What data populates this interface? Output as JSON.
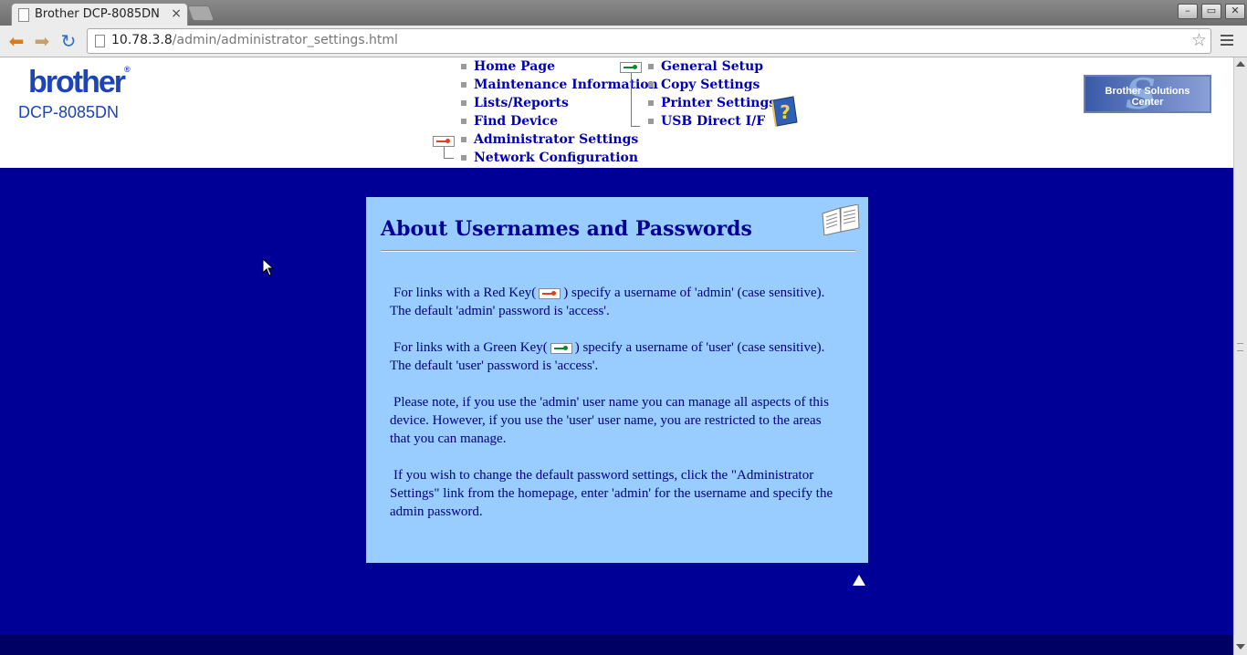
{
  "browser": {
    "tab_title": "Brother DCP-8085DN",
    "tab_close": "×",
    "url_host": "10.78.3.8",
    "url_path": "/admin/administrator_settings.html",
    "window_buttons": [
      "–",
      "▭",
      "✕"
    ]
  },
  "header": {
    "logo_text": "brother",
    "logo_mark": "®",
    "model": "DCP-8085DN",
    "solutions_center": "Brother Solutions Center"
  },
  "nav_left": [
    {
      "label": "Home Page"
    },
    {
      "label": "Maintenance Information"
    },
    {
      "label": "Lists/Reports"
    },
    {
      "label": "Find Device"
    },
    {
      "label": "Administrator Settings"
    },
    {
      "label": "Network Configuration"
    }
  ],
  "nav_right": [
    {
      "label": "General Setup"
    },
    {
      "label": "Copy Settings"
    },
    {
      "label": "Printer Settings"
    },
    {
      "label": "USB Direct I/F"
    }
  ],
  "panel": {
    "title": "About Usernames and Passwords",
    "p1_before": "For links with a Red Key(",
    "p1_after": ") specify a username of 'admin' (case sensitive). The default 'admin' password is 'access'.",
    "p2_before": "For links with a Green Key(",
    "p2_after": ") specify a username of 'user' (case sensitive). The default 'user' password is 'access'.",
    "p3": "Please note, if you use the 'admin' user name you can manage all aspects of this device. However, if you use the 'user' user name, you are restricted to the areas that you can manage.",
    "p4": "If you wish to change the default password settings, click the \"Administrator Settings\" link from the homepage, enter 'admin' for the username and specify the admin password."
  },
  "colors": {
    "page_background": "#000096",
    "panel_background": "#99ccff",
    "link": "#0000b4",
    "logo": "#1d44b8",
    "red_key": "#e04020",
    "green_key": "#0a8a2a"
  },
  "icons": [
    "back-arrow-icon",
    "forward-arrow-icon",
    "reload-icon",
    "star-icon",
    "menu-icon",
    "red-key-icon",
    "green-key-icon",
    "help-book-icon",
    "open-book-icon",
    "back-to-top-icon"
  ]
}
